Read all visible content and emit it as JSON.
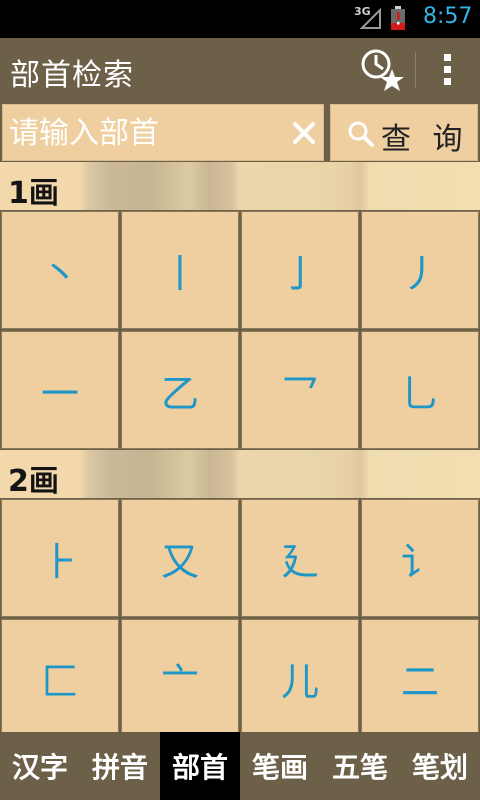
{
  "status_bar": {
    "network": "3G",
    "time": "8:57"
  },
  "action_bar": {
    "title": "部首检索",
    "history_icon": "clock-star-icon",
    "overflow_icon": "overflow-menu-icon"
  },
  "search": {
    "placeholder": "请输入部首",
    "value": "",
    "query_label": "查 询"
  },
  "sections": [
    {
      "header": "1画",
      "radicals": [
        "丶",
        "丨",
        "亅",
        "丿",
        "一",
        "乙",
        "乛",
        "乚"
      ]
    },
    {
      "header": "2画",
      "radicals": [
        "⺊",
        "又",
        "廴",
        "讠",
        "匚",
        "亠",
        "儿",
        "二"
      ]
    }
  ],
  "tabs": [
    {
      "label": "汉字",
      "active": false
    },
    {
      "label": "拼音",
      "active": false
    },
    {
      "label": "部首",
      "active": true
    },
    {
      "label": "笔画",
      "active": false
    },
    {
      "label": "五笔",
      "active": false
    },
    {
      "label": "笔划",
      "active": false
    }
  ],
  "colors": {
    "accent_time": "#33b5e5",
    "radical_text": "#1e97c8",
    "cell_bg": "#efcf9f",
    "bar_bg": "#6d6049",
    "active_tab_bg": "#000000"
  }
}
